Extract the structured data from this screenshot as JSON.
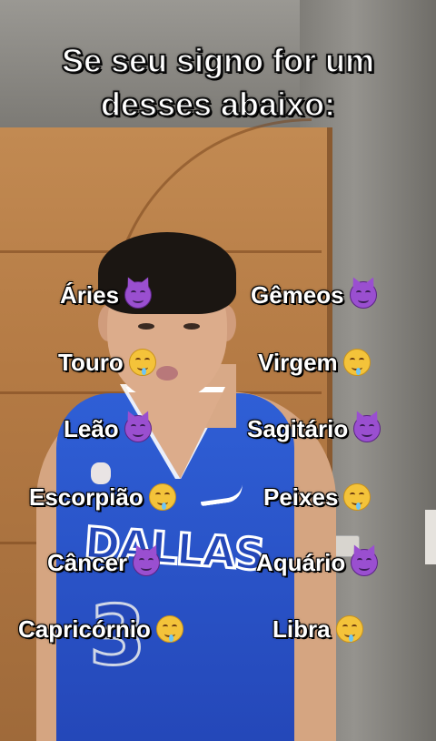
{
  "title": {
    "line1": "Se seu signo for um",
    "line2": "desses abaixo:"
  },
  "signs_left": [
    {
      "label": "Áries",
      "emoji": "smiling-devil-emoji"
    },
    {
      "label": "Touro",
      "emoji": "drooling-face-emoji"
    },
    {
      "label": "Leão",
      "emoji": "smiling-devil-emoji"
    },
    {
      "label": "Escorpião",
      "emoji": "drooling-face-emoji"
    },
    {
      "label": "Câncer",
      "emoji": "smiling-devil-emoji"
    },
    {
      "label": "Capricórnio",
      "emoji": "drooling-face-emoji"
    }
  ],
  "signs_right": [
    {
      "label": "Gêmeos",
      "emoji": "smiling-devil-emoji"
    },
    {
      "label": "Virgem",
      "emoji": "drooling-face-emoji"
    },
    {
      "label": "Sagitário",
      "emoji": "smiling-devil-emoji"
    },
    {
      "label": "Peixes",
      "emoji": "drooling-face-emoji"
    },
    {
      "label": "Aquário",
      "emoji": "smiling-devil-emoji"
    },
    {
      "label": "Libra",
      "emoji": "drooling-face-emoji"
    }
  ],
  "jersey": {
    "letters": "DALLAS",
    "number": "3"
  },
  "colors": {
    "text": "#ffffff",
    "outline": "#000000",
    "jersey_blue": "#2f5fd6"
  }
}
